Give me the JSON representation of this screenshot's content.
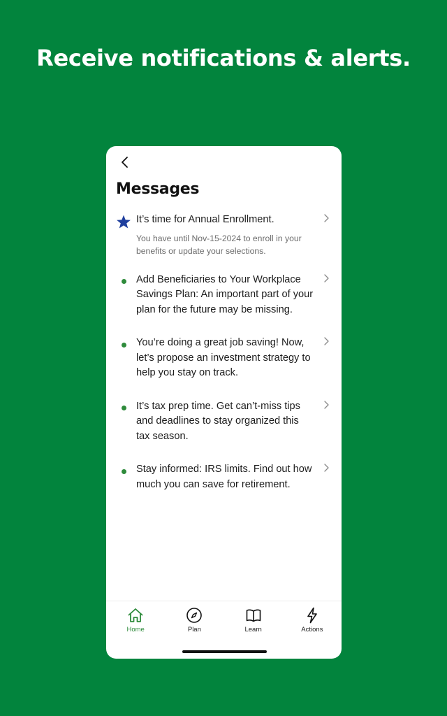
{
  "headline": "Receive notifications & alerts.",
  "screen": {
    "title": "Messages",
    "messages": [
      {
        "marker": "star-icon",
        "text": "It’s time for Annual Enrollment.",
        "sub": "You have until Nov-15-2024 to enroll in your benefits or update your selections."
      },
      {
        "marker": "dot",
        "text": "Add Beneficiaries to Your Workplace Savings Plan: An important part of your plan for the future may be missing."
      },
      {
        "marker": "dot",
        "text": "You’re doing a great job saving! Now, let’s propose an investment strategy to help you stay on track."
      },
      {
        "marker": "dot",
        "text": "It’s tax prep time. Get can’t-miss tips and deadlines to stay organized this tax season."
      },
      {
        "marker": "dot",
        "text": "Stay informed: IRS limits. Find out how much you can save for retirement."
      }
    ],
    "tabs": [
      {
        "label": "Home",
        "icon": "home-icon",
        "active": true
      },
      {
        "label": "Plan",
        "icon": "compass-icon",
        "active": false
      },
      {
        "label": "Learn",
        "icon": "book-icon",
        "active": false
      },
      {
        "label": "Actions",
        "icon": "lightning-icon",
        "active": false
      }
    ]
  },
  "colors": {
    "background": "#02843d",
    "accent": "#2e8b3b",
    "star": "#1f3f9e"
  }
}
